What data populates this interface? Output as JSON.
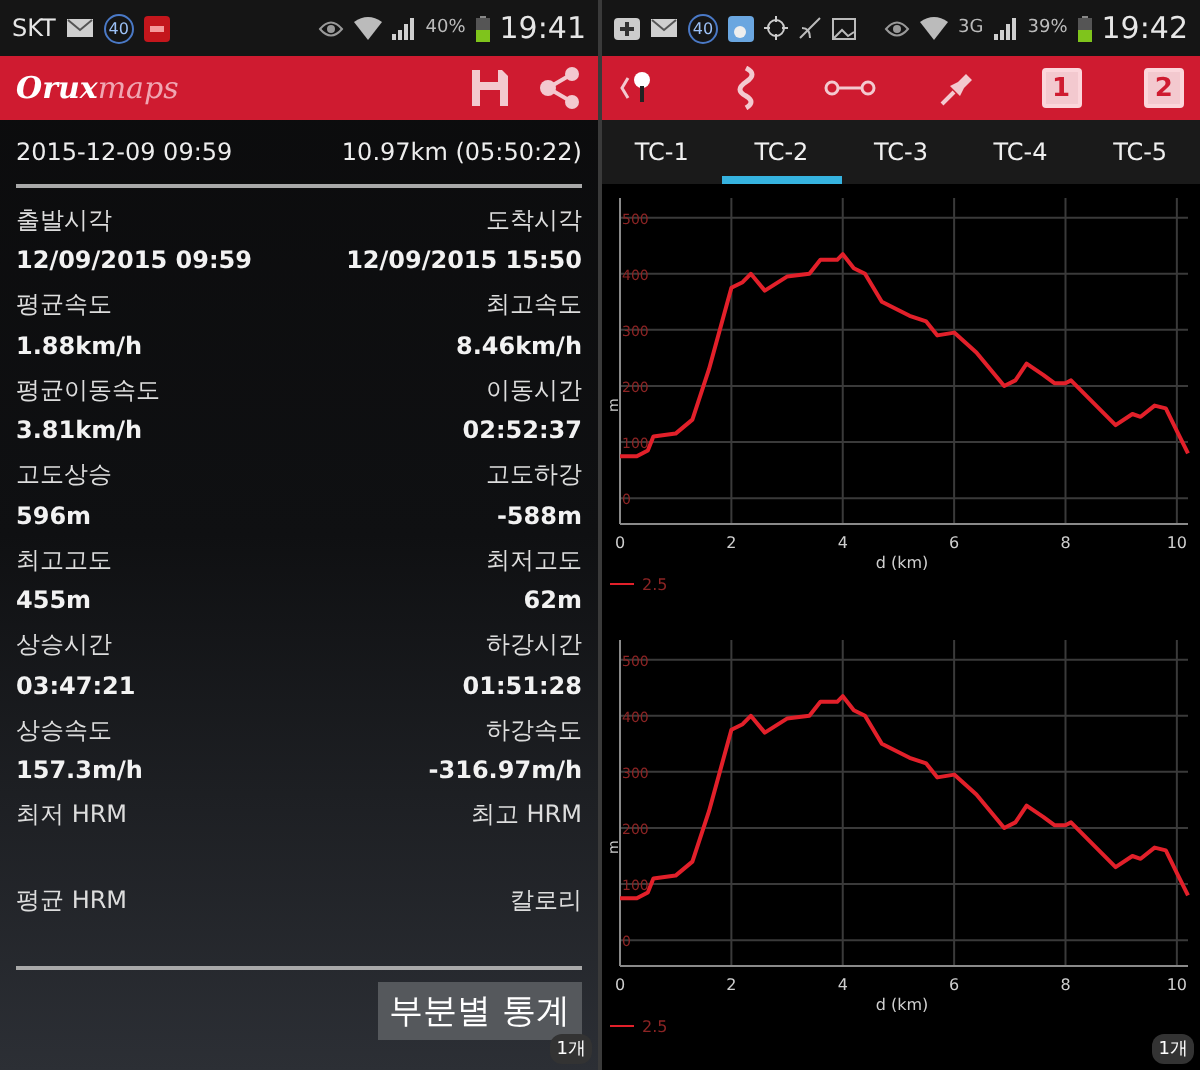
{
  "left": {
    "status_bar": {
      "carrier": "SKT",
      "badge": "40",
      "battery": "40%",
      "time": "19:41"
    },
    "app_bar": {
      "logo": "**Orux**maps"
    },
    "header": {
      "start": "2015-12-09 09:59",
      "summary": "10.97km (05:50:22)"
    },
    "stats": [
      {
        "left_label": "출발시각",
        "left_value": "12/09/2015 09:59",
        "right_label": "도착시각",
        "right_value": "12/09/2015 15:50"
      },
      {
        "left_label": "평균속도",
        "left_value": "1.88km/h",
        "right_label": "최고속도",
        "right_value": "8.46km/h"
      },
      {
        "left_label": "평균이동속도",
        "left_value": "3.81km/h",
        "right_label": "이동시간",
        "right_value": "02:52:37"
      },
      {
        "left_label": "고도상승",
        "left_value": "596m",
        "right_label": "고도하강",
        "right_value": "-588m"
      },
      {
        "left_label": "최고고도",
        "left_value": "455m",
        "right_label": "최저고도",
        "right_value": "62m"
      },
      {
        "left_label": "상승시간",
        "left_value": "03:47:21",
        "right_label": "하강시간",
        "right_value": "01:51:28"
      },
      {
        "left_label": "상승속도",
        "left_value": "157.3m/h",
        "right_label": "하강속도",
        "right_value": "-316.97m/h"
      },
      {
        "left_label": "최저 HRM",
        "right_label": "최고 HRM"
      },
      {
        "left_label": "평균 HRM",
        "right_label": "칼로리"
      }
    ],
    "button": "부분별 통계",
    "badge": "1개"
  },
  "right": {
    "status_bar": {
      "badge": "40",
      "network": "3G",
      "battery": "39%",
      "time": "19:42"
    },
    "toolbar": {
      "buttons": [
        "1",
        "2"
      ]
    },
    "tabs": [
      {
        "label": "TC-1",
        "selected": false
      },
      {
        "label": "TC-2",
        "selected": true
      },
      {
        "label": "TC-3",
        "selected": false
      },
      {
        "label": "TC-4",
        "selected": false
      },
      {
        "label": "TC-5",
        "selected": false
      }
    ],
    "charts": [
      {
        "chart_data": {
          "type": "line",
          "grid": true,
          "xlabel": "d (km)",
          "ylabel": "m",
          "xlim": [
            0,
            10.2
          ],
          "ylim": [
            -46,
            535
          ],
          "xticks": [
            0,
            2,
            4,
            6,
            8,
            10
          ],
          "yticks": [
            0,
            100,
            200,
            300,
            400,
            500
          ],
          "x": [
            0,
            0.3,
            0.5,
            0.6,
            1.0,
            1.3,
            1.6,
            2.0,
            2.2,
            2.35,
            2.6,
            3.0,
            3.4,
            3.6,
            3.9,
            4.0,
            4.2,
            4.4,
            4.7,
            5.2,
            5.5,
            5.7,
            6.0,
            6.4,
            6.9,
            7.1,
            7.3,
            7.6,
            7.8,
            8.0,
            8.1,
            8.5,
            8.9,
            9.2,
            9.35,
            9.6,
            9.8,
            10.0,
            10.2
          ],
          "series": [
            {
              "name": "2.5",
              "color": "#e2202a",
              "values": [
                75,
                75,
                85,
                110,
                115,
                140,
                230,
                375,
                385,
                400,
                370,
                395,
                400,
                425,
                425,
                435,
                410,
                400,
                350,
                325,
                315,
                290,
                295,
                260,
                200,
                210,
                240,
                220,
                205,
                205,
                210,
                170,
                130,
                150,
                145,
                165,
                160,
                120,
                80
              ]
            }
          ]
        }
      },
      {
        "chart_data": {
          "type": "line",
          "grid": true,
          "xlabel": "d (km)",
          "ylabel": "m",
          "xlim": [
            0,
            10.2
          ],
          "ylim": [
            -46,
            535
          ],
          "xticks": [
            0,
            2,
            4,
            6,
            8,
            10
          ],
          "yticks": [
            0,
            100,
            200,
            300,
            400,
            500
          ],
          "x": [
            0,
            0.3,
            0.5,
            0.6,
            1.0,
            1.3,
            1.6,
            2.0,
            2.2,
            2.35,
            2.6,
            3.0,
            3.4,
            3.6,
            3.9,
            4.0,
            4.2,
            4.4,
            4.7,
            5.2,
            5.5,
            5.7,
            6.0,
            6.4,
            6.9,
            7.1,
            7.3,
            7.6,
            7.8,
            8.0,
            8.1,
            8.5,
            8.9,
            9.2,
            9.35,
            9.6,
            9.8,
            10.0,
            10.2
          ],
          "series": [
            {
              "name": "2.5",
              "color": "#e2202a",
              "values": [
                75,
                75,
                85,
                110,
                115,
                140,
                230,
                375,
                385,
                400,
                370,
                395,
                400,
                425,
                425,
                435,
                410,
                400,
                350,
                325,
                315,
                290,
                295,
                260,
                200,
                210,
                240,
                220,
                205,
                205,
                210,
                170,
                130,
                150,
                145,
                165,
                160,
                120,
                80
              ]
            }
          ]
        }
      }
    ],
    "badge": "1개"
  }
}
